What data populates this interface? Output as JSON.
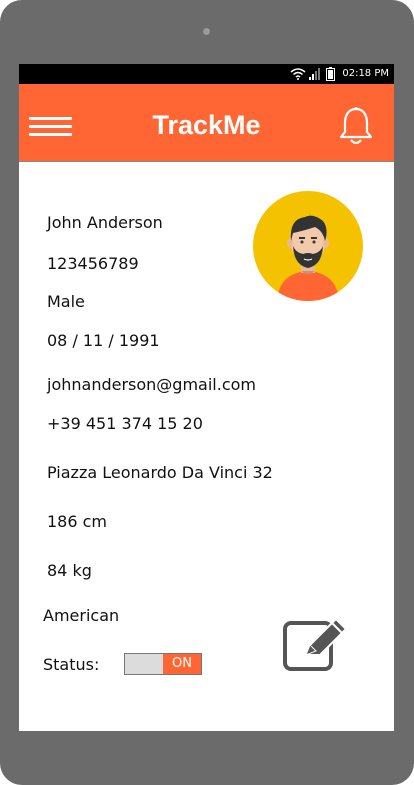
{
  "status_bar": {
    "time": "02:18 PM",
    "icons": [
      "wifi-icon",
      "signal-icon",
      "battery-icon"
    ]
  },
  "header": {
    "title": "TrackMe",
    "menu_icon": "hamburger-menu-icon",
    "notification_icon": "bell-icon"
  },
  "profile": {
    "name": "John Anderson",
    "id_number": "123456789",
    "gender": "Male",
    "birth_date": "08 / 11 / 1991",
    "email": "johnanderson@gmail.com",
    "phone": "+39 451 374 15 20",
    "address": "Piazza Leonardo Da Vinci 32",
    "height": "186 cm",
    "weight": "84 kg",
    "nationality": "American"
  },
  "status": {
    "label": "Status:",
    "toggle_text": "ON",
    "value": true
  },
  "edit_icon": "edit-icon",
  "colors": {
    "accent": "#ff6633",
    "avatar_bg": "#f5c200",
    "frame": "#6b6b6b"
  }
}
